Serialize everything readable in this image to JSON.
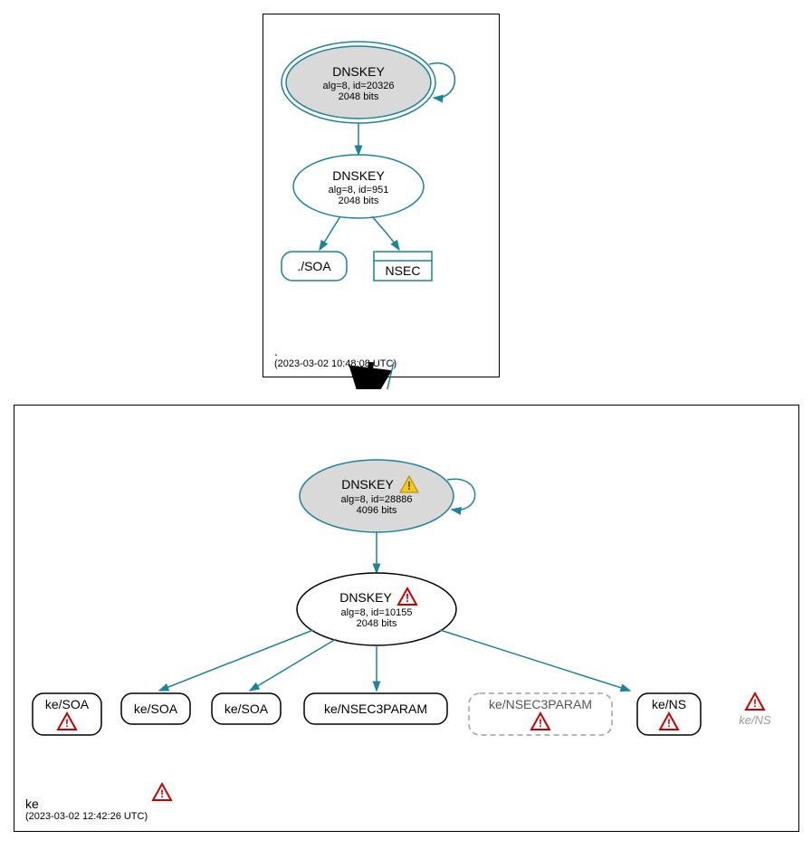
{
  "colors": {
    "teal": "#1B8495",
    "gray_fill": "#d9d9d9",
    "dash_gray": "#a0a0a0"
  },
  "icons": {
    "warn_yellow": "warning-yellow-icon",
    "warn_red": "warning-red-icon"
  },
  "zone_root": {
    "name": ".",
    "timestamp": "(2023-03-02 10:48:08 UTC)",
    "ksk": {
      "title": "DNSKEY",
      "line1": "alg=8, id=20326",
      "line2": "2048 bits"
    },
    "zsk": {
      "title": "DNSKEY",
      "line1": "alg=8, id=951",
      "line2": "2048 bits"
    },
    "leaves": {
      "soa": "./SOA",
      "nsec": "NSEC"
    }
  },
  "zone_ke": {
    "name": "ke",
    "timestamp": "(2023-03-02 12:42:26 UTC)",
    "ksk": {
      "title": "DNSKEY",
      "line1": "alg=8, id=28886",
      "line2": "4096 bits"
    },
    "zsk": {
      "title": "DNSKEY",
      "line1": "alg=8, id=10155",
      "line2": "2048 bits"
    },
    "leaves": {
      "soa1": "ke/SOA",
      "soa2": "ke/SOA",
      "soa3": "ke/SOA",
      "nsec3p1": "ke/NSEC3PARAM",
      "nsec3p2": "ke/NSEC3PARAM",
      "ns1": "ke/NS",
      "ns2": "ke/NS"
    }
  }
}
